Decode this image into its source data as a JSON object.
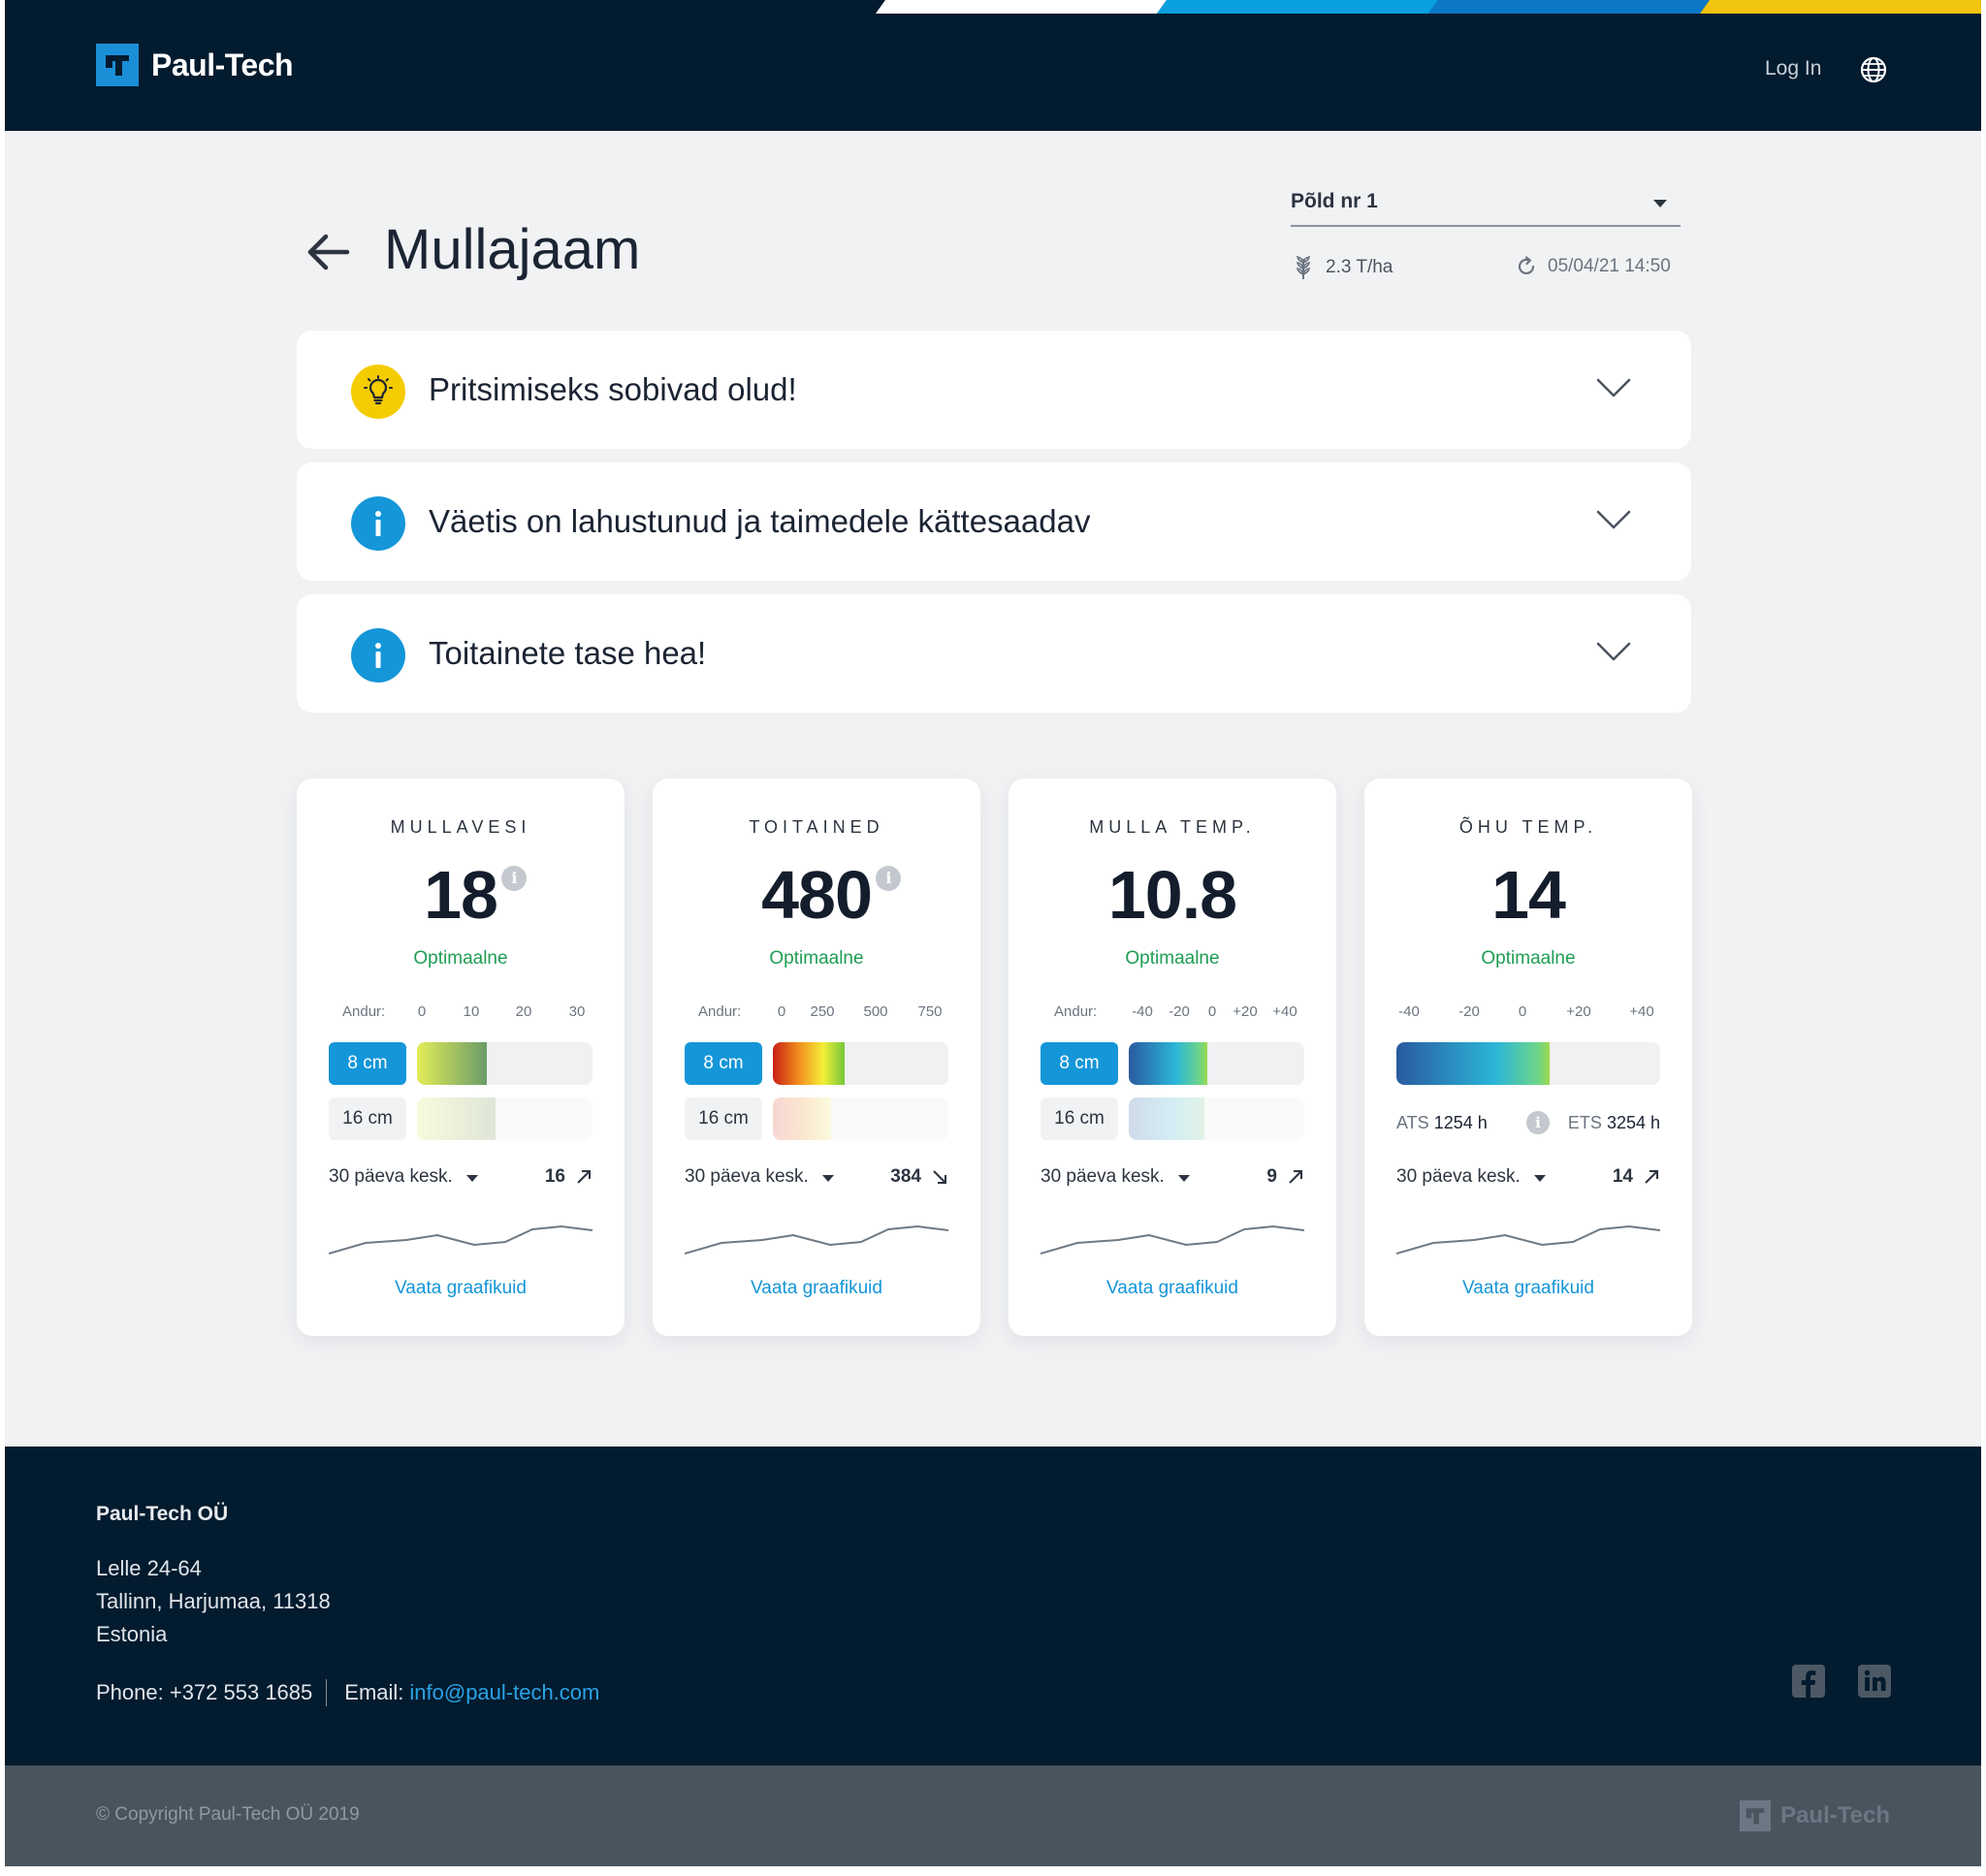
{
  "header": {
    "brand": "Paul-Tech",
    "login_label": "Log In",
    "icons": {
      "logo": "paul-tech-logo",
      "language": "globe-icon"
    },
    "stripe_colors": [
      "#ffffff",
      "#0aa0e0",
      "#0d78c8",
      "#f1c40f"
    ]
  },
  "page": {
    "title": "Mullajaam",
    "field_select": {
      "value": "Põld nr 1"
    },
    "yield": "2.3 T/ha",
    "updated": "05/04/21 14:50"
  },
  "alerts": [
    {
      "text": "Pritsimiseks sobivad olud!",
      "icon": "lightbulb-icon",
      "icon_color": "#f5cc00"
    },
    {
      "text": "Väetis on lahustunud ja taimedele kättesaadav",
      "icon": "info-icon",
      "icon_color": "#1496d8"
    },
    {
      "text": "Toitainete tase hea!",
      "icon": "info-icon",
      "icon_color": "#1496d8"
    }
  ],
  "cards": [
    {
      "title": "MULLAVESI",
      "value": "18",
      "status": "Optimaalne",
      "scale_label": "Andur:",
      "scale": [
        "0",
        "10",
        "20",
        "30"
      ],
      "depth_active": "8 cm",
      "depth_inactive": "16 cm",
      "level_8cm": 0.4,
      "level_16cm": 0.45,
      "avg_label": "30 päeva kesk.",
      "avg_value": "16",
      "trend": "up",
      "link": "Vaata graafikuid"
    },
    {
      "title": "TOITAINED",
      "value": "480",
      "status": "Optimaalne",
      "scale_label": "Andur:",
      "scale": [
        "0",
        "250",
        "500",
        "750"
      ],
      "depth_active": "8 cm",
      "depth_inactive": "16 cm",
      "level_8cm": 0.41,
      "level_16cm": 0.33,
      "avg_label": "30 päeva kesk.",
      "avg_value": "384",
      "trend": "down",
      "link": "Vaata graafikuid"
    },
    {
      "title": "MULLA TEMP.",
      "value": "10.8",
      "status": "Optimaalne",
      "scale_label": "Andur:",
      "scale": [
        "-40",
        "-20",
        "0",
        "+20",
        "+40"
      ],
      "depth_active": "8 cm",
      "depth_inactive": "16 cm",
      "level_8cm": 0.45,
      "level_16cm": 0.43,
      "avg_label": "30 päeva kesk.",
      "avg_value": "9",
      "trend": "up",
      "link": "Vaata graafikuid"
    },
    {
      "title": "ÕHU TEMP.",
      "value": "14",
      "status": "Optimaalne",
      "scale": [
        "-40",
        "-20",
        "0",
        "+20",
        "+40"
      ],
      "level": 0.58,
      "ats_label": "ATS",
      "ats_value": "1254 h",
      "ets_label": "ETS",
      "ets_value": "3254 h",
      "avg_label": "30 päeva kesk.",
      "avg_value": "14",
      "trend": "up",
      "link": "Vaata graafikuid"
    }
  ],
  "footer": {
    "company": "Paul-Tech OÜ",
    "address": [
      "Lelle 24-64",
      "Tallinn, Harjumaa, 11318",
      "Estonia"
    ],
    "phone": "Phone: +372 553 1685",
    "email_label": "Email:",
    "email": "info@paul-tech.com",
    "copyright": "© Copyright Paul-Tech OÜ 2019",
    "brand": "Paul-Tech",
    "social_icons": [
      "facebook-icon",
      "linkedin-icon"
    ]
  }
}
